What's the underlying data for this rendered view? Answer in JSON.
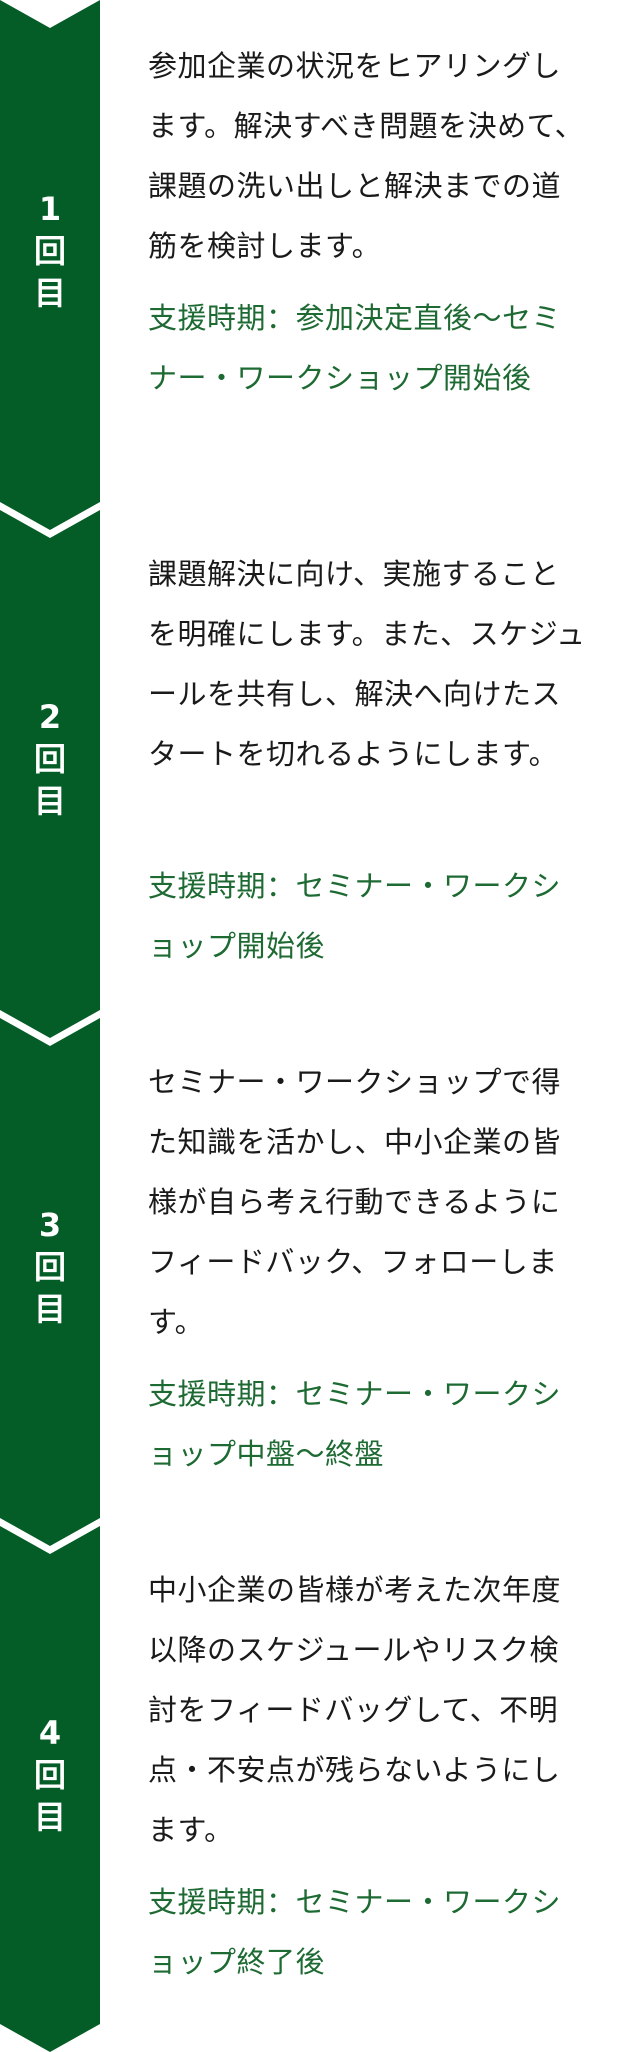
{
  "colors": {
    "arrow_green": "#045c26",
    "period_green": "#1e6a33",
    "text": "#1a1a1a",
    "background": "#ffffff"
  },
  "steps": [
    {
      "num": "1",
      "unit1": "回",
      "unit2": "目",
      "text": "参加企業の状況をヒアリングします。解決すべき問題を決めて、課題の洗い出しと解決までの道筋を検討します。",
      "period": "支援時期：参加決定直後〜セミナー・ワークショップ開始後"
    },
    {
      "num": "2",
      "unit1": "回",
      "unit2": "目",
      "text": "課題解決に向け、実施することを明確にします。また、スケジュールを共有し、解決へ向けたスタートを切れるようにします。",
      "period": "支援時期：セミナー・ワークショップ開始後"
    },
    {
      "num": "3",
      "unit1": "回",
      "unit2": "目",
      "text": "セミナー・ワークショップで得た知識を活かし、中小企業の皆様が自ら考え行動できるようにフィードバック、フォローします。",
      "period": "支援時期：セミナー・ワークショップ中盤〜終盤"
    },
    {
      "num": "4",
      "unit1": "回",
      "unit2": "目",
      "text": "中小企業の皆様が考えた次年度以降のスケジュールやリスク検討をフィードバッグして、不明点・不安点が残らないようにします。",
      "period": "支援時期：セミナー・ワークショップ終了後"
    }
  ]
}
